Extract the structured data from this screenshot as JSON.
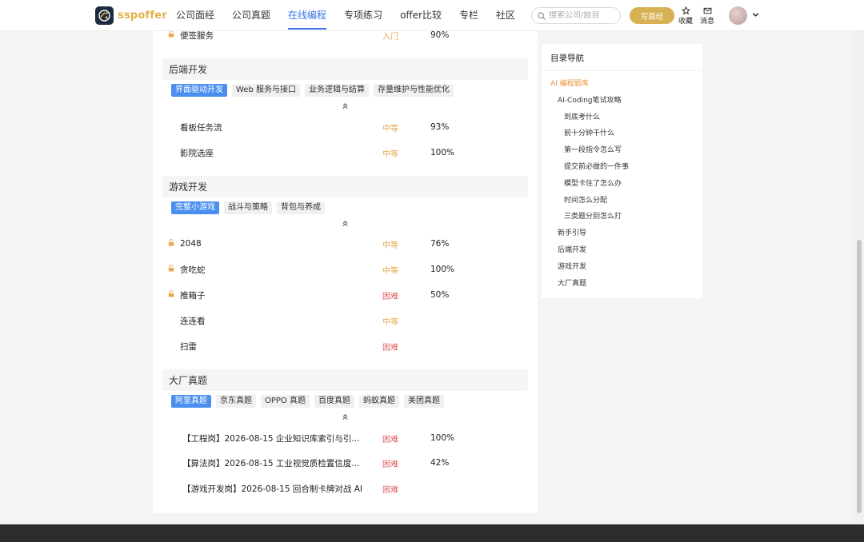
{
  "header": {
    "logo_text": "sspoffer",
    "nav": [
      "公司面经",
      "公司真题",
      "在线编程",
      "专项练习",
      "offer比较",
      "专栏",
      "社区"
    ],
    "nav_active_index": 2,
    "search_placeholder": "搜索公司/题目",
    "write_label": "写面经",
    "favorite_label": "收藏",
    "message_label": "消息",
    "accent": "#3b74e6",
    "brand": "#e4b04a"
  },
  "top_row": {
    "title": "便签服务",
    "difficulty": "入门",
    "rate": "90%",
    "locked": true
  },
  "sections": [
    {
      "heading": "后端开发",
      "tabs": [
        "界面驱动开发",
        "Web 服务与接口",
        "业务逻辑与结算",
        "存量维护与性能优化"
      ],
      "active_tab": 0,
      "rows": [
        {
          "title": "看板任务流",
          "difficulty": "中等",
          "rate": "93%",
          "locked": false
        },
        {
          "title": "影院选座",
          "difficulty": "中等",
          "rate": "100%",
          "locked": false
        }
      ]
    },
    {
      "heading": "游戏开发",
      "tabs": [
        "完整小游戏",
        "战斗与策略",
        "背包与养成"
      ],
      "active_tab": 0,
      "rows": [
        {
          "title": "2048",
          "difficulty": "中等",
          "rate": "76%",
          "locked": true
        },
        {
          "title": "贪吃蛇",
          "difficulty": "中等",
          "rate": "100%",
          "locked": true
        },
        {
          "title": "推箱子",
          "difficulty": "困难",
          "rate": "50%",
          "locked": true
        },
        {
          "title": "连连看",
          "difficulty": "中等",
          "rate": "",
          "locked": false
        },
        {
          "title": "扫雷",
          "difficulty": "困难",
          "rate": "",
          "locked": false
        }
      ]
    },
    {
      "heading": "大厂真题",
      "tabs": [
        "阿里真题",
        "京东真题",
        "OPPO 真题",
        "百度真题",
        "蚂蚁真题",
        "美团真题"
      ],
      "active_tab": 0,
      "rows": [
        {
          "title": "【工程岗】2026-08-15 企业知识库索引与引...",
          "difficulty": "困难",
          "rate": "100%",
          "locked": false
        },
        {
          "title": "【算法岗】2026-08-15 工业视觉质检置信度...",
          "difficulty": "困难",
          "rate": "42%",
          "locked": false
        },
        {
          "title": "【游戏开发岗】2026-08-15 回合制卡牌对战 AI",
          "difficulty": "困难",
          "rate": "",
          "locked": false
        }
      ]
    }
  ],
  "toc": {
    "title": "目录导航",
    "items": [
      {
        "label": "AI 编程题库",
        "level": 0,
        "active": true
      },
      {
        "label": "AI-Coding笔试攻略",
        "level": 1,
        "active": false
      },
      {
        "label": "到底考什么",
        "level": 2,
        "active": false
      },
      {
        "label": "前十分钟干什么",
        "level": 2,
        "active": false
      },
      {
        "label": "第一段指令怎么写",
        "level": 2,
        "active": false
      },
      {
        "label": "提交前必做的一件事",
        "level": 2,
        "active": false
      },
      {
        "label": "模型卡住了怎么办",
        "level": 2,
        "active": false
      },
      {
        "label": "时间怎么分配",
        "level": 2,
        "active": false
      },
      {
        "label": "三类题分别怎么打",
        "level": 2,
        "active": false
      },
      {
        "label": "新手引导",
        "level": 1,
        "active": false
      },
      {
        "label": "后端开发",
        "level": 1,
        "active": false
      },
      {
        "label": "游戏开发",
        "level": 1,
        "active": false
      },
      {
        "label": "大厂真题",
        "level": 1,
        "active": false
      }
    ]
  },
  "colors": {
    "medium": "#e8a74a",
    "hard": "#e25b5b",
    "tab_active": "#4a8ef0",
    "toc_active": "#e8953a"
  }
}
